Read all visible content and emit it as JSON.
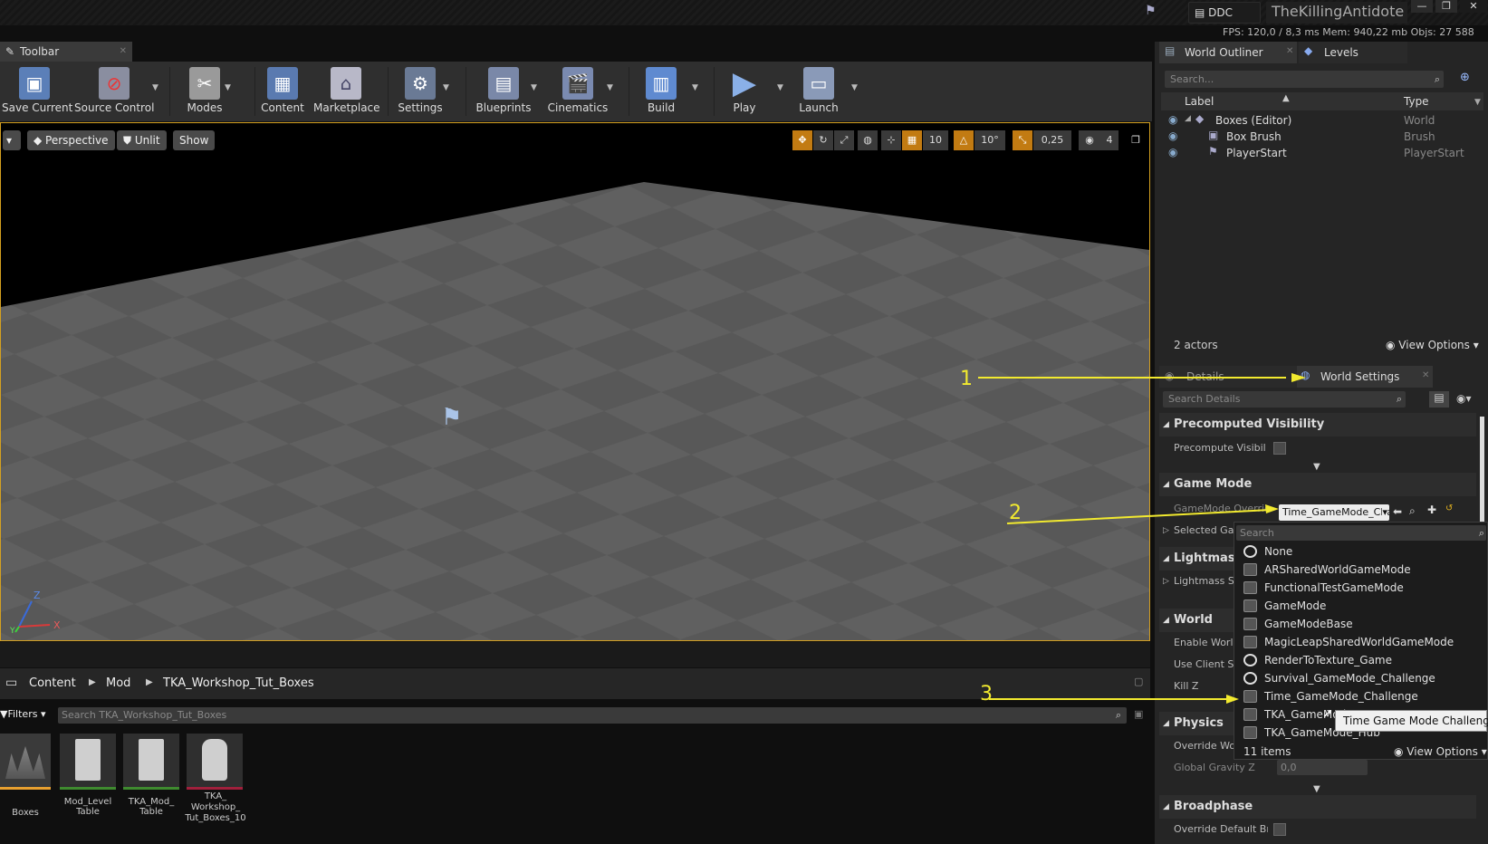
{
  "titlebar": {
    "ddc": "DDC",
    "project": "TheKillingAntidote",
    "stats": "FPS: 120,0 / 8,3 ms Mem: 940,22 mb Objs: 27 588"
  },
  "toolbar": {
    "tab_label": "Toolbar",
    "buttons": [
      {
        "label": "Save Current"
      },
      {
        "label": "Source Control"
      },
      {
        "label": "Modes"
      },
      {
        "label": "Content"
      },
      {
        "label": "Marketplace"
      },
      {
        "label": "Settings"
      },
      {
        "label": "Blueprints"
      },
      {
        "label": "Cinematics"
      },
      {
        "label": "Build"
      },
      {
        "label": "Play"
      },
      {
        "label": "Launch"
      }
    ]
  },
  "viewport": {
    "perspective": "Perspective",
    "unlit": "Unlit",
    "show": "Show",
    "grid_snap": "10",
    "rot_snap": "10°",
    "scale_snap": "0,25",
    "cam_speed": "4",
    "axis_z": "Z",
    "axis_x": "X",
    "axis_y": "Y"
  },
  "content_browser": {
    "breadcrumb": [
      "Content",
      "Mod",
      "TKA_Workshop_Tut_Boxes"
    ],
    "filters": "Filters",
    "search_placeholder": "Search TKA_Workshop_Tut_Boxes",
    "assets": [
      {
        "name": "Boxes",
        "color": "#e8a030"
      },
      {
        "name": "Mod_Level Table",
        "color": "#3f8a2f"
      },
      {
        "name": "TKA_Mod_ Table",
        "color": "#3f8a2f"
      },
      {
        "name": "TKA_ Workshop_ Tut_Boxes_10",
        "color": "#a0203c"
      }
    ]
  },
  "outliner": {
    "tab": "World Outliner",
    "tab2": "Levels",
    "search_placeholder": "Search...",
    "col_label": "Label",
    "col_type": "Type",
    "rows": [
      {
        "label": "Boxes (Editor)",
        "type": "World"
      },
      {
        "label": "Box Brush",
        "type": "Brush"
      },
      {
        "label": "PlayerStart",
        "type": "PlayerStart"
      }
    ],
    "count": "2 actors",
    "view_options": "View Options"
  },
  "details": {
    "tab_details": "Details",
    "tab_world": "World Settings",
    "search_placeholder": "Search Details",
    "categories": {
      "precomputed": "Precomputed Visibility",
      "gamemode": "Game Mode",
      "lightmass": "Lightmass",
      "world": "World",
      "physics": "Physics",
      "broadphase": "Broadphase"
    },
    "props": {
      "precompute": "Precompute Visibility",
      "gm_override": "GameMode Override",
      "selected_gm": "Selected GameMode",
      "lightmass_settings": "Lightmass Settings",
      "enable_world": "Enable World Bounds Checks",
      "use_client": "Use Client Side Level Streaming",
      "killz": "Kill Z",
      "override_world": "Override World Gravity",
      "global_gravity": "Global Gravity Z",
      "override_broad": "Override Default Broadphase"
    },
    "gm_value": "Time_GameMode_Challenge",
    "gravity_value": "0,0"
  },
  "popup": {
    "search_placeholder": "Search",
    "items": [
      {
        "label": "None",
        "icon": "circle"
      },
      {
        "label": "ARSharedWorldGameMode",
        "icon": "blueprint"
      },
      {
        "label": "FunctionalTestGameMode",
        "icon": "blueprint"
      },
      {
        "label": "GameMode",
        "icon": "blueprint"
      },
      {
        "label": "GameModeBase",
        "icon": "blueprint"
      },
      {
        "label": "MagicLeapSharedWorldGameMode",
        "icon": "blueprint"
      },
      {
        "label": "RenderToTexture_Game",
        "icon": "circle"
      },
      {
        "label": "Survival_GameMode_Challenge",
        "icon": "circle"
      },
      {
        "label": "Time_GameMode_Challenge",
        "icon": "blueprint"
      },
      {
        "label": "TKA_GameMode",
        "icon": "blueprint"
      },
      {
        "label": "TKA_GameMode_Hub",
        "icon": "blueprint"
      }
    ],
    "count": "11 items",
    "view_options": "View Options",
    "tooltip": "Time Game Mode Challenge"
  },
  "annotations": [
    "1",
    "2",
    "3"
  ]
}
